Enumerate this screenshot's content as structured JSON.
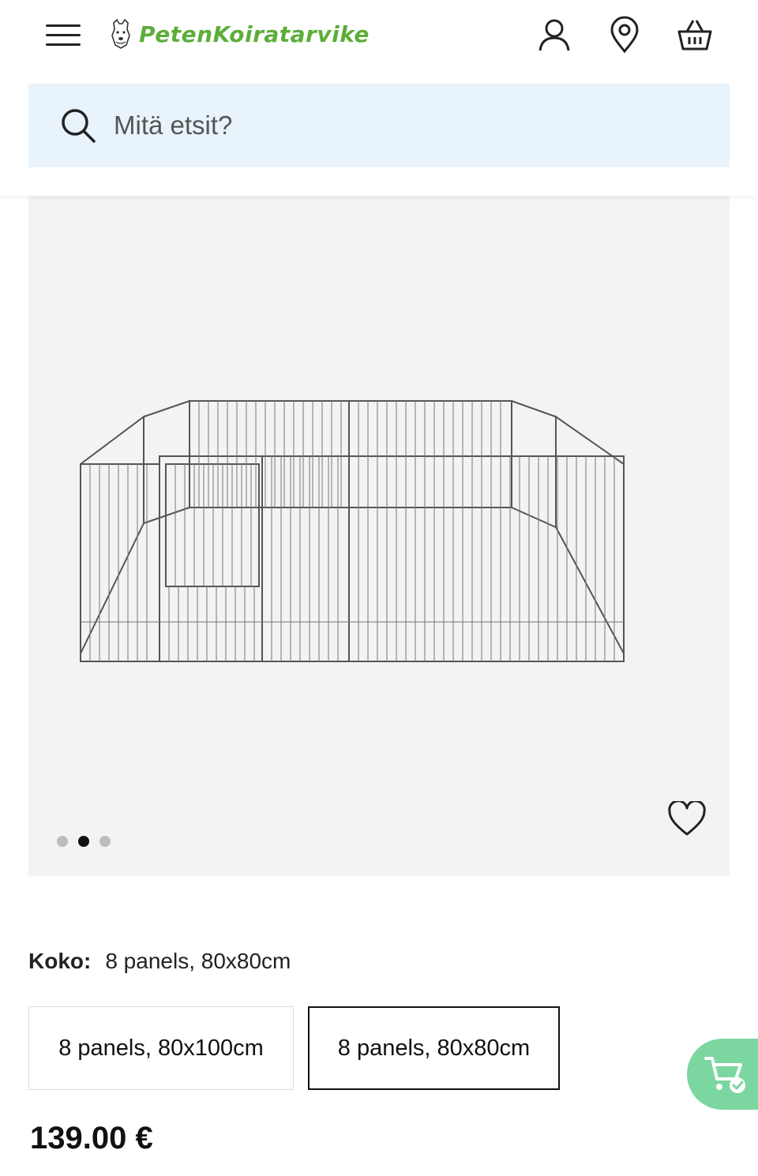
{
  "header": {
    "brand": "PetenKoiratarvike",
    "icons": {
      "menu": "hamburger-menu-icon",
      "account": "user-icon",
      "store_locator": "location-pin-icon",
      "cart": "basket-icon"
    }
  },
  "search": {
    "placeholder": "Mitä etsit?"
  },
  "gallery": {
    "image": "metal-dog-playpen-8-panels",
    "slides": 3,
    "active_slide": 2
  },
  "product": {
    "size_label": "Koko:",
    "selected_size": "8 panels, 80x80cm",
    "variants": [
      {
        "label": "8 panels, 80x100cm",
        "selected": false
      },
      {
        "label": "8 panels, 80x80cm",
        "selected": true
      }
    ],
    "price": "139.00 €"
  },
  "colors": {
    "brand_green": "#5cae3a",
    "search_bg": "#e8f3fb",
    "gallery_bg": "#f3f3f3",
    "cart_fab": "#7bd6a0"
  }
}
